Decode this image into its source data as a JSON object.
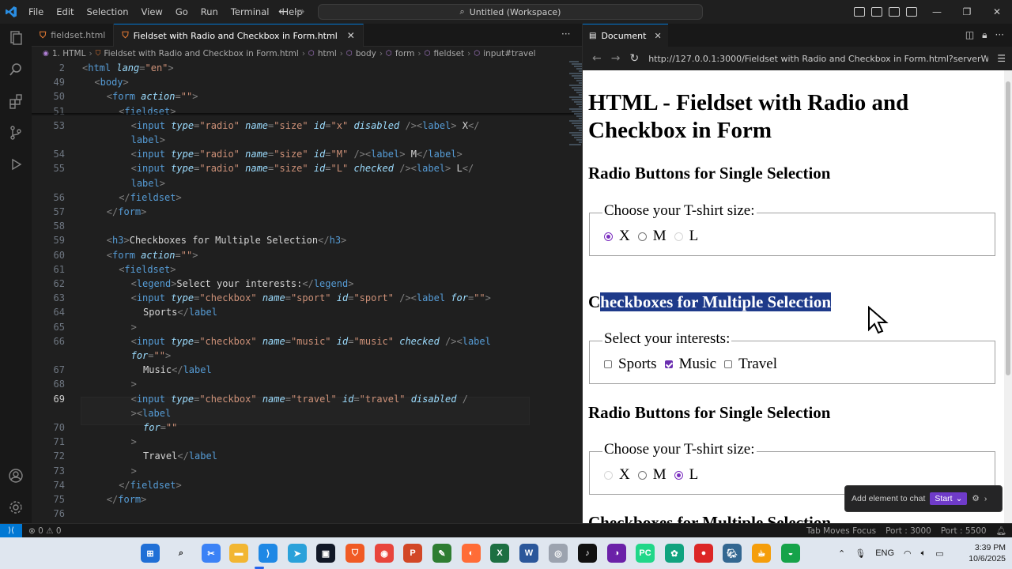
{
  "menu": [
    "File",
    "Edit",
    "Selection",
    "View",
    "Go",
    "Run",
    "Terminal",
    "Help"
  ],
  "command_center": "Untitled (Workspace)",
  "editor_tabs": [
    {
      "label": "fieldset.html",
      "active": false
    },
    {
      "label": "Fieldset with Radio and Checkbox in Form.html",
      "active": true
    }
  ],
  "breadcrumb": [
    "1. HTML",
    "Fieldset with Radio and Checkbox in Form.html",
    "html",
    "body",
    "form",
    "fieldset",
    "input#travel"
  ],
  "code_lines": [
    {
      "n": "2",
      "segs": [
        [
          "tag",
          "<"
        ],
        [
          "tn",
          "html "
        ],
        [
          "an",
          "lang"
        ],
        [
          "tag",
          "="
        ],
        [
          "av",
          "\"en\""
        ],
        [
          "tag",
          ">"
        ]
      ],
      "indent": 0
    },
    {
      "n": "49",
      "segs": [
        [
          "tag",
          "<"
        ],
        [
          "tn",
          "body"
        ],
        [
          "tag",
          ">"
        ]
      ],
      "indent": 1
    },
    {
      "n": "50",
      "segs": [
        [
          "tag",
          "<"
        ],
        [
          "tn",
          "form "
        ],
        [
          "an",
          "action"
        ],
        [
          "tag",
          "="
        ],
        [
          "av",
          "\"\""
        ],
        [
          "tag",
          ">"
        ]
      ],
      "indent": 2
    },
    {
      "n": "51",
      "segs": [
        [
          "tag",
          "<"
        ],
        [
          "tn",
          "fieldset"
        ],
        [
          "tag",
          ">"
        ]
      ],
      "indent": 3
    },
    {
      "n": "53",
      "segs": [
        [
          "tag",
          "<"
        ],
        [
          "tn",
          "input "
        ],
        [
          "an",
          "type"
        ],
        [
          "tag",
          "="
        ],
        [
          "av",
          "\"radio\" "
        ],
        [
          "an",
          "name"
        ],
        [
          "tag",
          "="
        ],
        [
          "av",
          "\"size\" "
        ],
        [
          "an",
          "id"
        ],
        [
          "tag",
          "="
        ],
        [
          "av",
          "\"x\" "
        ],
        [
          "an",
          "disabled "
        ],
        [
          "tag",
          "/><"
        ],
        [
          "tn",
          "label"
        ],
        [
          "tag",
          "> "
        ],
        [
          "tx",
          "X"
        ],
        [
          "tag",
          "</"
        ]
      ],
      "indent": 4
    },
    {
      "n": "",
      "segs": [
        [
          "tn",
          "label"
        ],
        [
          "tag",
          ">"
        ]
      ],
      "indent": 4
    },
    {
      "n": "54",
      "segs": [
        [
          "tag",
          "<"
        ],
        [
          "tn",
          "input "
        ],
        [
          "an",
          "type"
        ],
        [
          "tag",
          "="
        ],
        [
          "av",
          "\"radio\" "
        ],
        [
          "an",
          "name"
        ],
        [
          "tag",
          "="
        ],
        [
          "av",
          "\"size\" "
        ],
        [
          "an",
          "id"
        ],
        [
          "tag",
          "="
        ],
        [
          "av",
          "\"M\" "
        ],
        [
          "tag",
          "/><"
        ],
        [
          "tn",
          "label"
        ],
        [
          "tag",
          "> "
        ],
        [
          "tx",
          "M"
        ],
        [
          "tag",
          "</"
        ],
        [
          "tn",
          "label"
        ],
        [
          "tag",
          ">"
        ]
      ],
      "indent": 4
    },
    {
      "n": "55",
      "segs": [
        [
          "tag",
          "<"
        ],
        [
          "tn",
          "input "
        ],
        [
          "an",
          "type"
        ],
        [
          "tag",
          "="
        ],
        [
          "av",
          "\"radio\" "
        ],
        [
          "an",
          "name"
        ],
        [
          "tag",
          "="
        ],
        [
          "av",
          "\"size\" "
        ],
        [
          "an",
          "id"
        ],
        [
          "tag",
          "="
        ],
        [
          "av",
          "\"L\" "
        ],
        [
          "an",
          "checked "
        ],
        [
          "tag",
          "/><"
        ],
        [
          "tn",
          "label"
        ],
        [
          "tag",
          "> "
        ],
        [
          "tx",
          "L"
        ],
        [
          "tag",
          "</"
        ]
      ],
      "indent": 4
    },
    {
      "n": "",
      "segs": [
        [
          "tn",
          "label"
        ],
        [
          "tag",
          ">"
        ]
      ],
      "indent": 4
    },
    {
      "n": "56",
      "segs": [
        [
          "tag",
          "</"
        ],
        [
          "tn",
          "fieldset"
        ],
        [
          "tag",
          ">"
        ]
      ],
      "indent": 3
    },
    {
      "n": "57",
      "segs": [
        [
          "tag",
          "</"
        ],
        [
          "tn",
          "form"
        ],
        [
          "tag",
          ">"
        ]
      ],
      "indent": 2
    },
    {
      "n": "58",
      "segs": [],
      "indent": 0
    },
    {
      "n": "59",
      "segs": [
        [
          "tag",
          "<"
        ],
        [
          "tn",
          "h3"
        ],
        [
          "tag",
          ">"
        ],
        [
          "tx",
          "Checkboxes for Multiple Selection"
        ],
        [
          "tag",
          "</"
        ],
        [
          "tn",
          "h3"
        ],
        [
          "tag",
          ">"
        ]
      ],
      "indent": 2
    },
    {
      "n": "60",
      "segs": [
        [
          "tag",
          "<"
        ],
        [
          "tn",
          "form "
        ],
        [
          "an",
          "action"
        ],
        [
          "tag",
          "="
        ],
        [
          "av",
          "\"\""
        ],
        [
          "tag",
          ">"
        ]
      ],
      "indent": 2
    },
    {
      "n": "61",
      "segs": [
        [
          "tag",
          "<"
        ],
        [
          "tn",
          "fieldset"
        ],
        [
          "tag",
          ">"
        ]
      ],
      "indent": 3
    },
    {
      "n": "62",
      "segs": [
        [
          "tag",
          "<"
        ],
        [
          "tn",
          "legend"
        ],
        [
          "tag",
          ">"
        ],
        [
          "tx",
          "Select your interests:"
        ],
        [
          "tag",
          "</"
        ],
        [
          "tn",
          "legend"
        ],
        [
          "tag",
          ">"
        ]
      ],
      "indent": 4
    },
    {
      "n": "63",
      "segs": [
        [
          "tag",
          "<"
        ],
        [
          "tn",
          "input "
        ],
        [
          "an",
          "type"
        ],
        [
          "tag",
          "="
        ],
        [
          "av",
          "\"checkbox\" "
        ],
        [
          "an",
          "name"
        ],
        [
          "tag",
          "="
        ],
        [
          "av",
          "\"sport\" "
        ],
        [
          "an",
          "id"
        ],
        [
          "tag",
          "="
        ],
        [
          "av",
          "\"sport\" "
        ],
        [
          "tag",
          "/><"
        ],
        [
          "tn",
          "label "
        ],
        [
          "an",
          "for"
        ],
        [
          "tag",
          "="
        ],
        [
          "av",
          "\"\""
        ],
        [
          "tag",
          ">"
        ]
      ],
      "indent": 4
    },
    {
      "n": "64",
      "segs": [
        [
          "tx",
          "Sports"
        ],
        [
          "tag",
          "</"
        ],
        [
          "tn",
          "label"
        ]
      ],
      "indent": 5
    },
    {
      "n": "65",
      "segs": [
        [
          "tag",
          ">"
        ]
      ],
      "indent": 4
    },
    {
      "n": "66",
      "segs": [
        [
          "tag",
          "<"
        ],
        [
          "tn",
          "input "
        ],
        [
          "an",
          "type"
        ],
        [
          "tag",
          "="
        ],
        [
          "av",
          "\"checkbox\" "
        ],
        [
          "an",
          "name"
        ],
        [
          "tag",
          "="
        ],
        [
          "av",
          "\"music\" "
        ],
        [
          "an",
          "id"
        ],
        [
          "tag",
          "="
        ],
        [
          "av",
          "\"music\" "
        ],
        [
          "an",
          "checked "
        ],
        [
          "tag",
          "/><"
        ],
        [
          "tn",
          "label"
        ]
      ],
      "indent": 4
    },
    {
      "n": "",
      "segs": [
        [
          "an",
          "for"
        ],
        [
          "tag",
          "="
        ],
        [
          "av",
          "\"\""
        ],
        [
          "tag",
          ">"
        ]
      ],
      "indent": 4
    },
    {
      "n": "67",
      "segs": [
        [
          "tx",
          "Music"
        ],
        [
          "tag",
          "</"
        ],
        [
          "tn",
          "label"
        ]
      ],
      "indent": 5
    },
    {
      "n": "68",
      "segs": [
        [
          "tag",
          ">"
        ]
      ],
      "indent": 4
    },
    {
      "n": "69",
      "segs": [
        [
          "tag",
          "<"
        ],
        [
          "tn",
          "input "
        ],
        [
          "an",
          "type"
        ],
        [
          "tag",
          "="
        ],
        [
          "av",
          "\"checkbox\" "
        ],
        [
          "an",
          "name"
        ],
        [
          "tag",
          "="
        ],
        [
          "av",
          "\"travel\" "
        ],
        [
          "an",
          "id"
        ],
        [
          "tag",
          "="
        ],
        [
          "av",
          "\"travel\" "
        ],
        [
          "an",
          "disabled "
        ],
        [
          "tag",
          "/"
        ]
      ],
      "indent": 4,
      "current": true
    },
    {
      "n": "",
      "segs": [
        [
          "tag",
          "><"
        ],
        [
          "tn",
          "label"
        ]
      ],
      "indent": 4
    },
    {
      "n": "70",
      "segs": [
        [
          "an",
          "for"
        ],
        [
          "tag",
          "="
        ],
        [
          "av",
          "\"\""
        ]
      ],
      "indent": 5
    },
    {
      "n": "71",
      "segs": [
        [
          "tag",
          ">"
        ]
      ],
      "indent": 4
    },
    {
      "n": "72",
      "segs": [
        [
          "tx",
          "Travel"
        ],
        [
          "tag",
          "</"
        ],
        [
          "tn",
          "label"
        ]
      ],
      "indent": 5
    },
    {
      "n": "73",
      "segs": [
        [
          "tag",
          ">"
        ]
      ],
      "indent": 4
    },
    {
      "n": "74",
      "segs": [
        [
          "tag",
          "</"
        ],
        [
          "tn",
          "fieldset"
        ],
        [
          "tag",
          ">"
        ]
      ],
      "indent": 3
    },
    {
      "n": "75",
      "segs": [
        [
          "tag",
          "</"
        ],
        [
          "tn",
          "form"
        ],
        [
          "tag",
          ">"
        ]
      ],
      "indent": 2
    },
    {
      "n": "76",
      "segs": [],
      "indent": 0
    }
  ],
  "browser": {
    "tab_label": "Document",
    "url": "http://127.0.0.1:3000/Fieldset with Radio and Checkbox in Form.html?serverWindowId=",
    "page": {
      "h1": "HTML - Fieldset with Radio and Checkbox in Form",
      "section1_title": "Radio Buttons for Single Selection",
      "legend_size": "Choose your T-shirt size:",
      "size_options": [
        {
          "label": "X",
          "state": "checked"
        },
        {
          "label": "M",
          "state": "normal"
        },
        {
          "label": "L",
          "state": "disabled"
        }
      ],
      "section2_title_first": "C",
      "section2_title_rest": "heckboxes for Multiple Selection",
      "legend_interests": "Select your interests:",
      "interest_options": [
        {
          "label": "Sports",
          "checked": false
        },
        {
          "label": "Music",
          "checked": true
        },
        {
          "label": "Travel",
          "checked": false
        }
      ],
      "section3_title": "Radio Buttons for Single Selection",
      "legend_size2": "Choose your T-shirt size:",
      "size_options2": [
        {
          "label": "X",
          "state": "disabled"
        },
        {
          "label": "M",
          "state": "normal"
        },
        {
          "label": "L",
          "state": "checked"
        }
      ],
      "section4_title": "Checkboxes for Multiple Selection"
    }
  },
  "chat_popup": {
    "label": "Add element to chat",
    "start": "Start"
  },
  "statusbar": {
    "problems": "⊗ 0 ⚠ 0",
    "tab_moves_focus": "Tab Moves Focus",
    "port1": "Port : 3000",
    "port2": "Port : 5500"
  },
  "tray": {
    "lang": "ENG",
    "time": "3:39 PM",
    "date": "10/6/2025"
  },
  "colors": {
    "accent": "#0078d4",
    "checkbox_accent": "#6b2fb0",
    "selection": "#1e3a8a"
  }
}
